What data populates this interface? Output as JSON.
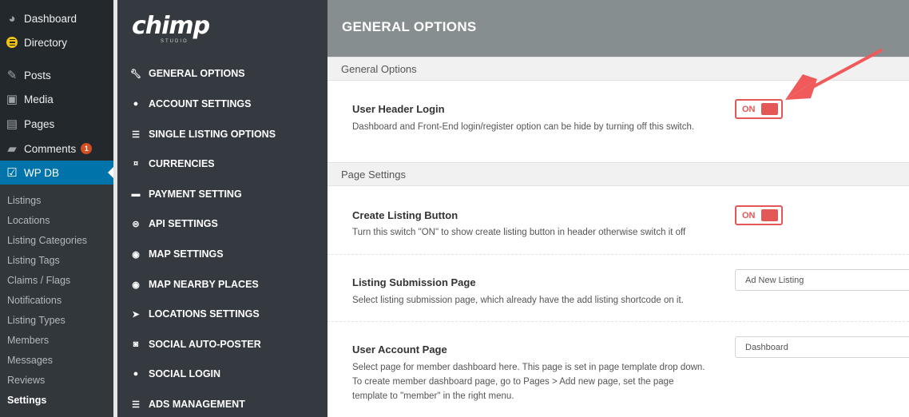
{
  "wp_menu": {
    "items": [
      {
        "label": "Dashboard",
        "icon": "dashboard-icon"
      },
      {
        "label": "Directory",
        "icon": "directory-icon"
      },
      {
        "label": "Posts",
        "icon": "pin-icon"
      },
      {
        "label": "Media",
        "icon": "media-icon"
      },
      {
        "label": "Pages",
        "icon": "pages-icon"
      },
      {
        "label": "Comments",
        "icon": "comment-icon",
        "badge": "1"
      },
      {
        "label": "WP DB",
        "icon": "checkbox-icon",
        "active": true
      }
    ],
    "submenu": [
      "Listings",
      "Locations",
      "Listing Categories",
      "Listing Tags",
      "Claims / Flags",
      "Notifications",
      "Listing Types",
      "Members",
      "Messages",
      "Reviews",
      "Settings"
    ],
    "current_submenu": "Settings"
  },
  "logo": {
    "text": "chimp",
    "sub": "STUDIO"
  },
  "plugin_nav": {
    "items": [
      {
        "label": "GENERAL OPTIONS",
        "icon": "wrench-icon"
      },
      {
        "label": "ACCOUNT SETTINGS",
        "icon": "user-icon"
      },
      {
        "label": "SINGLE LISTING OPTIONS",
        "icon": "list-icon"
      },
      {
        "label": "CURRENCIES",
        "icon": "currency-icon"
      },
      {
        "label": "PAYMENT SETTING",
        "icon": "card-icon"
      },
      {
        "label": "API SETTINGS",
        "icon": "api-icon"
      },
      {
        "label": "MAP SETTINGS",
        "icon": "map-marker-icon"
      },
      {
        "label": "MAP NEARBY PLACES",
        "icon": "map-marker-icon"
      },
      {
        "label": "LOCATIONS SETTINGS",
        "icon": "location-arrow-icon"
      },
      {
        "label": "SOCIAL AUTO-POSTER",
        "icon": "chat-icon"
      },
      {
        "label": "SOCIAL LOGIN",
        "icon": "user-icon"
      },
      {
        "label": "ADS MANAGEMENT",
        "icon": "list-icon"
      }
    ]
  },
  "main": {
    "title": "GENERAL OPTIONS",
    "sections": [
      {
        "title": "General Options"
      },
      {
        "title": "Page Settings"
      }
    ],
    "options": {
      "user_header_login": {
        "title": "User Header Login",
        "desc": "Dashboard and Front-End login/register option can be hide by turning off this switch.",
        "toggle": "ON"
      },
      "create_listing_button": {
        "title": "Create Listing Button",
        "desc": "Turn this switch \"ON\" to show create listing button in header otherwise switch it off",
        "toggle": "ON"
      },
      "listing_submission_page": {
        "title": "Listing Submission Page",
        "desc": "Select listing submission page, which already have the add listing shortcode on it.",
        "select": "Ad New Listing"
      },
      "user_account_page": {
        "title": "User Account Page",
        "desc": "Select page for member dashboard here. This page is set in page template drop down. To create member dashboard page, go to Pages > Add new page, set the page template to \"member\" in the right menu.",
        "select": "Dashboard"
      }
    }
  },
  "colors": {
    "accent": "#e45757",
    "wp_active": "#0073aa",
    "header_bg": "#868e90"
  }
}
